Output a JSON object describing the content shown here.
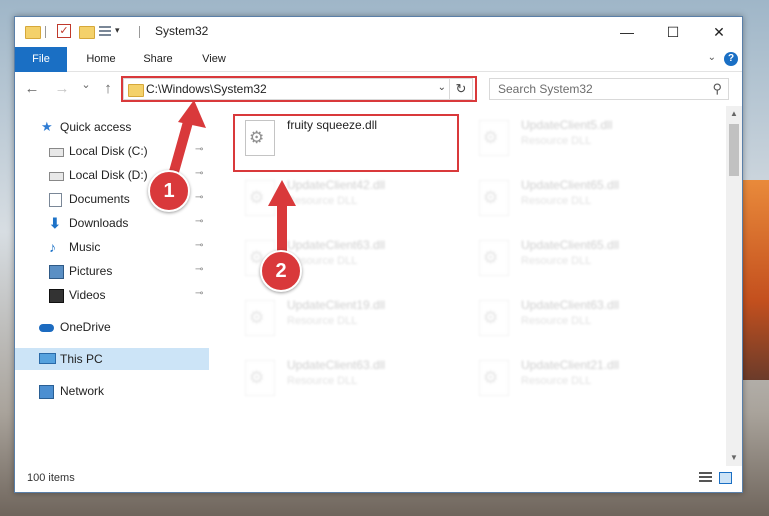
{
  "window": {
    "title": "System32",
    "controls": {
      "minimize": "—",
      "maximize": "☐",
      "close": "✕"
    }
  },
  "ribbon": {
    "tabs": [
      "File",
      "Home",
      "Share",
      "View"
    ],
    "help": "?"
  },
  "navbar": {
    "back": "←",
    "forward": "→",
    "recent": "⌄",
    "up": "↑",
    "address": "C:\\Windows\\System32",
    "address_dropdown": "⌄",
    "refresh": "↻",
    "search_placeholder": "Search System32"
  },
  "sidebar": {
    "items": [
      {
        "label": "Quick access",
        "icon": "star-icon"
      },
      {
        "label": "Local Disk (C:)",
        "icon": "drive-icon",
        "pinned": true
      },
      {
        "label": "Local Disk (D:)",
        "icon": "drive-icon",
        "pinned": true
      },
      {
        "label": "Documents",
        "icon": "documents-icon",
        "pinned": true
      },
      {
        "label": "Downloads",
        "icon": "download-icon",
        "pinned": true
      },
      {
        "label": "Music",
        "icon": "music-icon",
        "pinned": true
      },
      {
        "label": "Pictures",
        "icon": "pictures-icon",
        "pinned": true
      },
      {
        "label": "Videos",
        "icon": "videos-icon",
        "pinned": true
      },
      {
        "label": "OneDrive",
        "icon": "cloud-icon"
      },
      {
        "label": "This PC",
        "icon": "computer-icon",
        "selected": true
      },
      {
        "label": "Network",
        "icon": "network-icon"
      }
    ],
    "pin_glyph": "📌"
  },
  "files": [
    {
      "name": "fruity squeeze.dll",
      "type": ""
    },
    {
      "name": "UpdateClient5.dll",
      "type": "Resource DLL"
    },
    {
      "name": "UpdateClient42.dll",
      "type": "Resource DLL"
    },
    {
      "name": "UpdateClient65.dll",
      "type": "Resource DLL"
    },
    {
      "name": "UpdateClient63.dll",
      "type": "Resource DLL"
    },
    {
      "name": "UpdateClient65.dll",
      "type": "Resource DLL"
    },
    {
      "name": "UpdateClient19.dll",
      "type": "Resource DLL"
    },
    {
      "name": "UpdateClient63.dll",
      "type": "Resource DLL"
    },
    {
      "name": "UpdateClient63.dll",
      "type": "Resource DLL"
    },
    {
      "name": "UpdateClient21.dll",
      "type": "Resource DLL"
    }
  ],
  "status": {
    "item_count": "100 items"
  },
  "annotations": {
    "step1": "1",
    "step2": "2",
    "color": "#d9393b"
  }
}
